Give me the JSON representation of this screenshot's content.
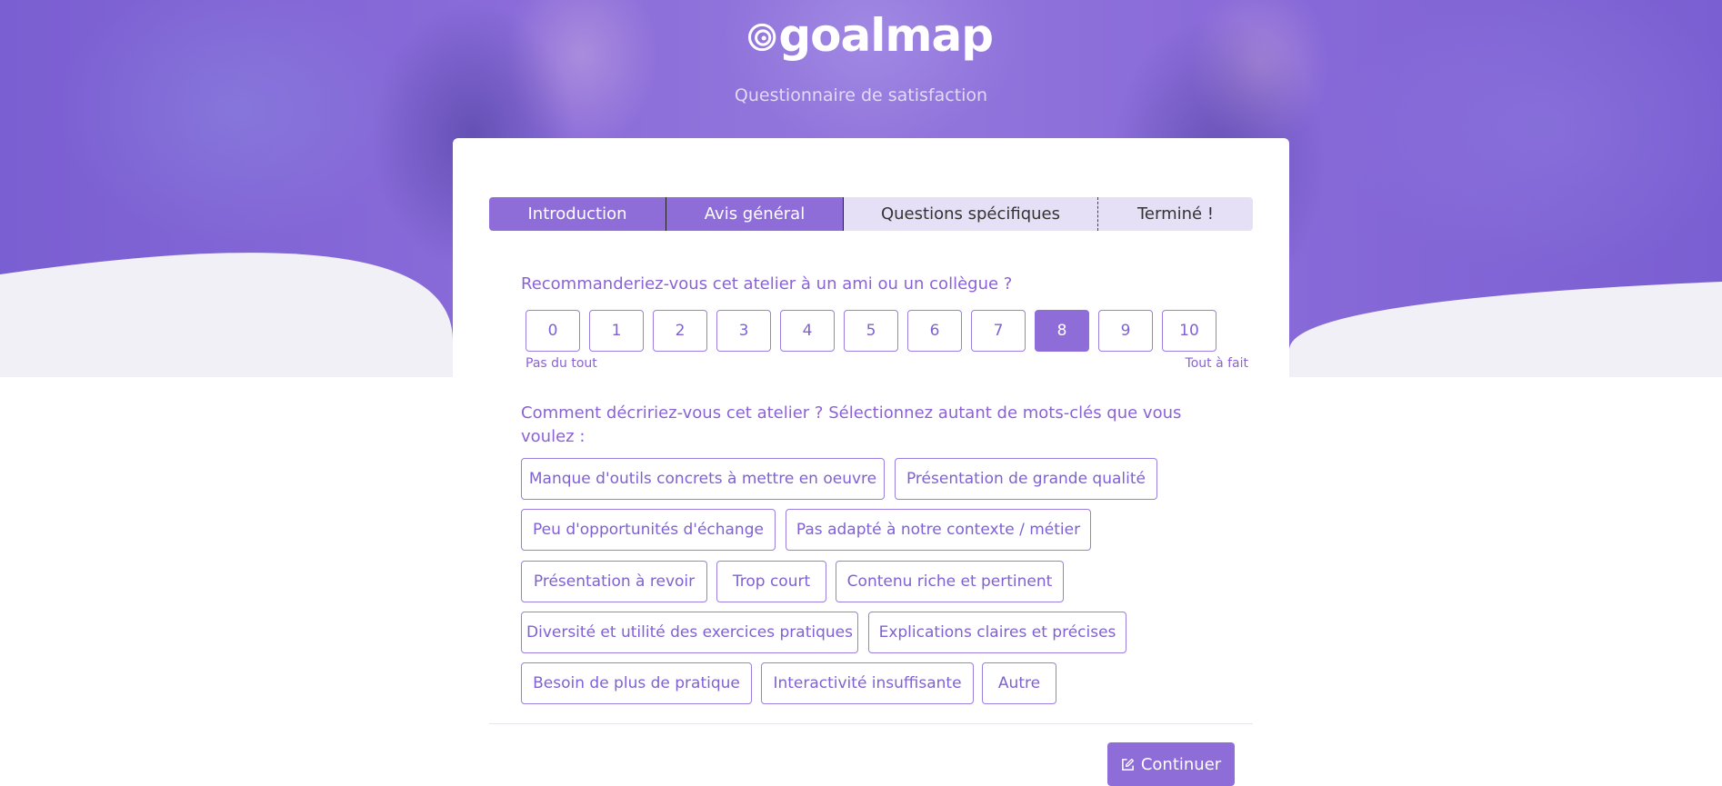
{
  "header": {
    "logo_text": "goalmap",
    "subtitle": "Questionnaire de satisfaction"
  },
  "steps": [
    {
      "label": "Introduction",
      "state": "done"
    },
    {
      "label": "Avis général",
      "state": "done"
    },
    {
      "label": "Questions spécifiques",
      "state": "todo"
    },
    {
      "label": "Terminé !",
      "state": "todo"
    }
  ],
  "question1": {
    "text": "Recommanderiez-vous cet atelier à un ami ou un collègue ?",
    "scores": [
      "0",
      "1",
      "2",
      "3",
      "4",
      "5",
      "6",
      "7",
      "8",
      "9",
      "10"
    ],
    "selected": "8",
    "min_label": "Pas du tout",
    "max_label": "Tout à fait"
  },
  "question2": {
    "text": "Comment décririez-vous cet atelier ? Sélectionnez autant de mots-clés que vous voulez :",
    "keywords": [
      "Manque d'outils concrets à mettre en oeuvre",
      "Présentation de grande qualité",
      "Peu d'opportunités d'échange",
      "Pas adapté à notre contexte / métier",
      "Présentation à revoir",
      "Trop court",
      "Contenu riche et pertinent",
      "Diversité et utilité des exercices pratiques",
      "Explications claires et précises",
      "Besoin de plus de pratique",
      "Interactivité insuffisante",
      "Autre"
    ]
  },
  "actions": {
    "continue_label": "Continuer"
  },
  "colors": {
    "accent": "#8f6dd8",
    "accent_text": "#8a62d6",
    "step_pending": "#e6e0f6",
    "wave": "#f2f0f7"
  },
  "icons": {
    "logo": "goalmap-target-logo",
    "continue": "edit-square-icon"
  }
}
